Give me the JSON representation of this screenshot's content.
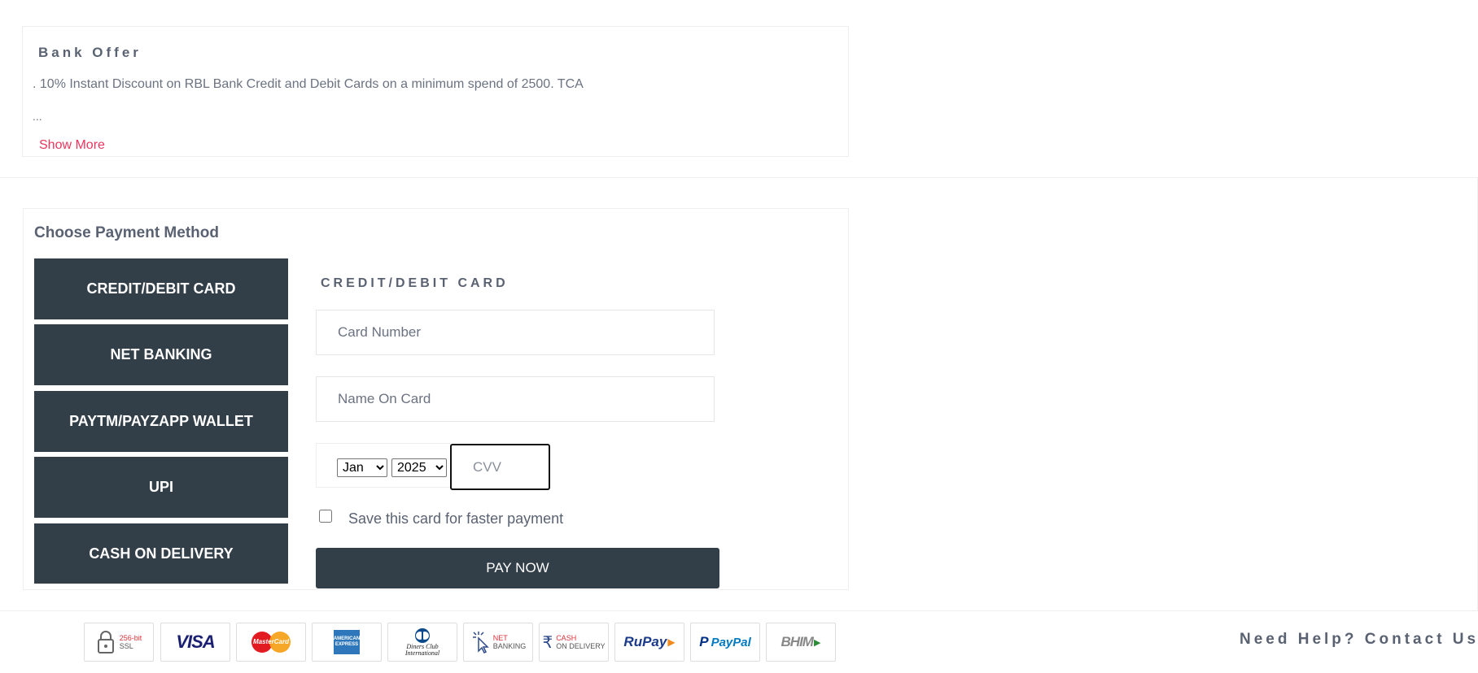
{
  "offer": {
    "title": "Bank Offer",
    "text": ". 10% Instant Discount on RBL Bank Credit and Debit Cards on a minimum spend of 2500. TCA",
    "ellipsis": "...",
    "show_more": "Show More"
  },
  "payment": {
    "heading": "Choose Payment Method",
    "methods": [
      {
        "label": "CREDIT/DEBIT CARD"
      },
      {
        "label": "NET BANKING"
      },
      {
        "label": "PAYTM/PAYZAPP WALLET"
      },
      {
        "label": "UPI"
      },
      {
        "label": "CASH ON DELIVERY"
      }
    ],
    "selected_method": "CREDIT/DEBIT CARD",
    "form": {
      "title": "CREDIT/DEBIT CARD",
      "card_number_placeholder": "Card Number",
      "name_placeholder": "Name On Card",
      "month": "Jan",
      "year": "2025",
      "cvv_placeholder": "CVV",
      "save_card_label": "Save this card for faster payment",
      "pay_now": "PAY NOW"
    }
  },
  "footer": {
    "badges": [
      {
        "icon": "ssl-lock-icon",
        "line1": "256-bit",
        "line2": "SSL"
      },
      {
        "icon": "visa-logo-icon",
        "text": "VISA"
      },
      {
        "icon": "mastercard-logo-icon",
        "text": "MasterCard"
      },
      {
        "icon": "amex-logo-icon",
        "text": "AMERICAN EXPRESS"
      },
      {
        "icon": "diners-club-logo-icon",
        "line1": "Diners Club",
        "line2": "International"
      },
      {
        "icon": "net-banking-icon",
        "line1": "NET",
        "line2": "BANKING"
      },
      {
        "icon": "cash-on-delivery-icon",
        "line1": "CASH",
        "line2": "ON DELIVERY"
      },
      {
        "icon": "rupay-logo-icon",
        "text": "RuPay"
      },
      {
        "icon": "paypal-logo-icon",
        "text": "PayPal"
      },
      {
        "icon": "bhim-logo-icon",
        "text": "BHIM"
      }
    ],
    "help_text": "Need Help? Contact Us"
  },
  "colors": {
    "button_dark": "#323e48",
    "link_pink": "#e8365d",
    "text_grey": "#5a6272"
  }
}
